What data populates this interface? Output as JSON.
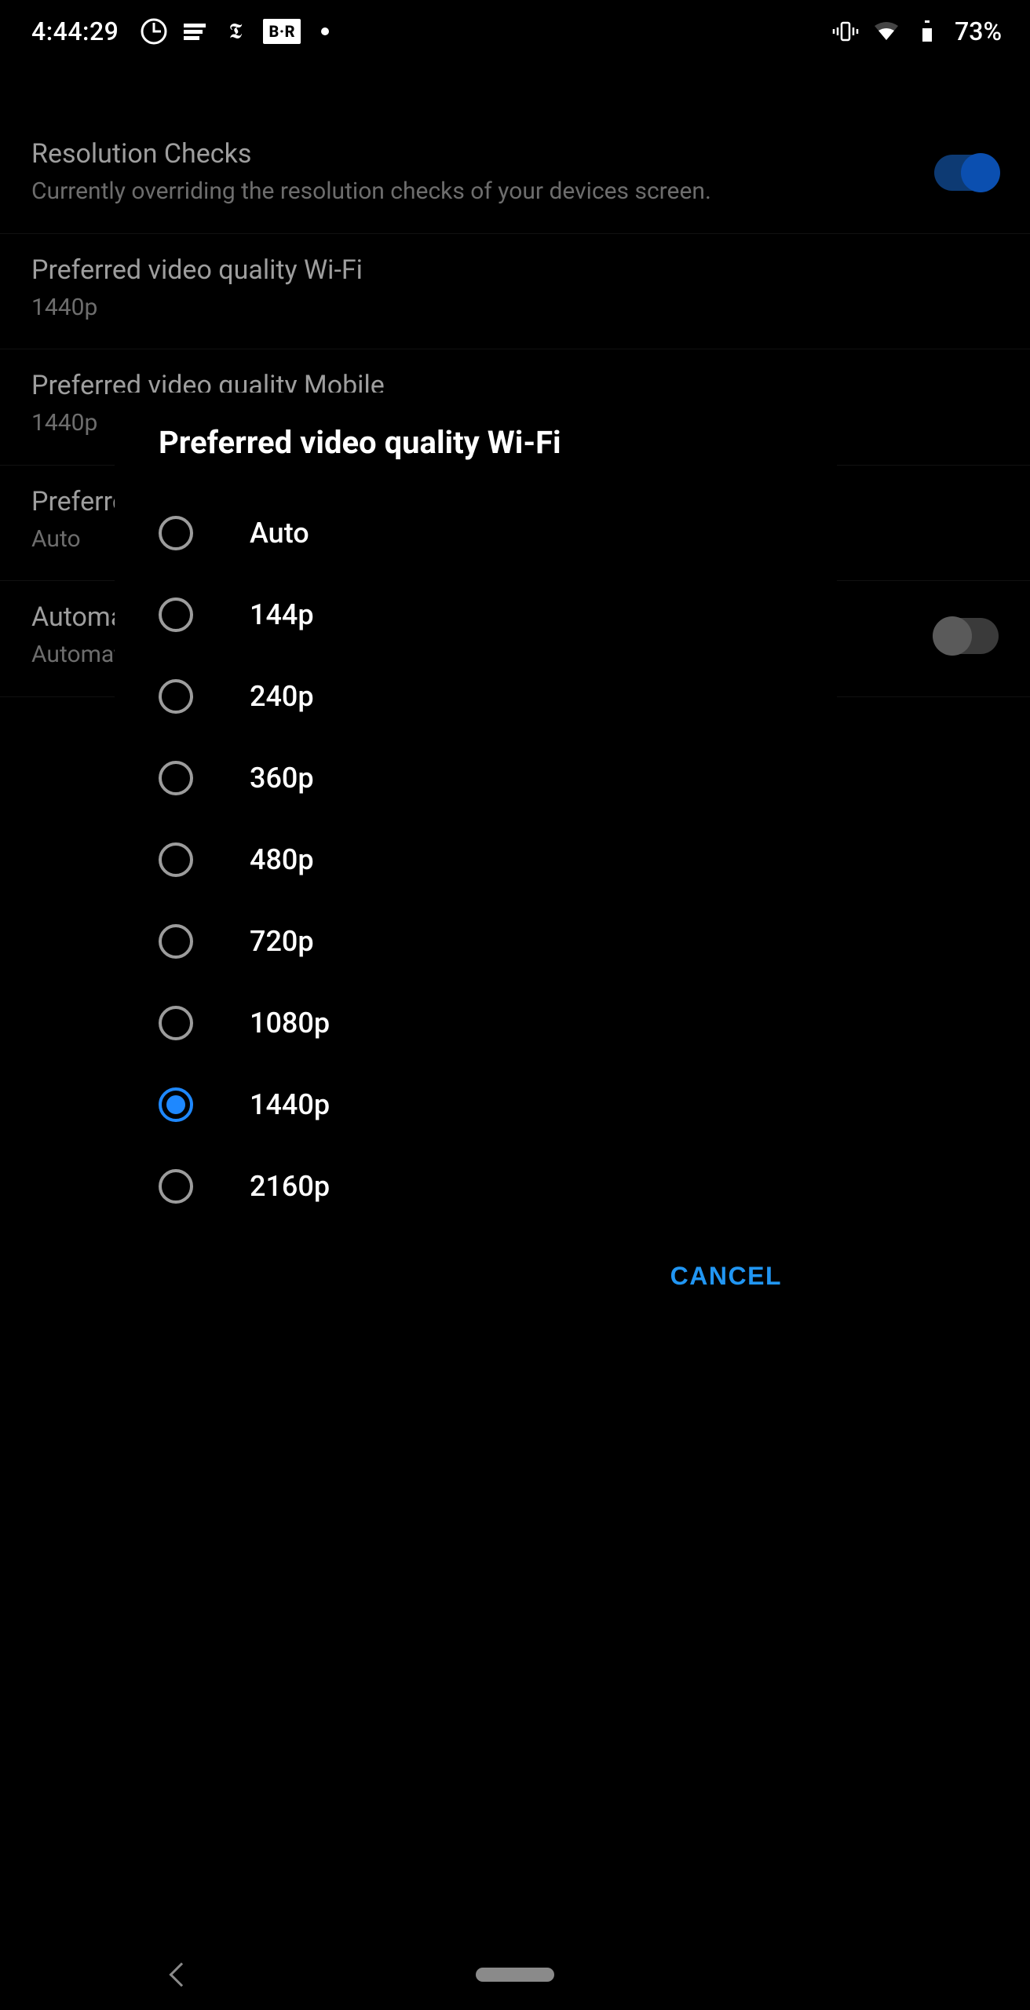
{
  "status": {
    "time": "4:44:29",
    "battery_pct": "73%",
    "icons": [
      "guardian",
      "espn",
      "nyt",
      "br",
      "dot"
    ],
    "right_icons": [
      "vibrate",
      "wifi",
      "battery"
    ]
  },
  "settings": {
    "rows": [
      {
        "title": "Resolution Checks",
        "sub": "Currently overriding the resolution checks of your devices screen.",
        "switch": "on"
      },
      {
        "title": "Preferred video quality Wi-Fi",
        "sub": "1440p",
        "switch": null
      },
      {
        "title": "Preferred video quality Mobile",
        "sub": "1440p",
        "switch": null
      },
      {
        "title": "Preferred video speed",
        "sub": "Auto",
        "switch": null
      },
      {
        "title": "Automatic captions",
        "sub": "Automatic captions",
        "switch": "off"
      }
    ]
  },
  "dialog": {
    "title": "Preferred video quality Wi-Fi",
    "selected": "1440p",
    "options": [
      "Auto",
      "144p",
      "240p",
      "360p",
      "480p",
      "720p",
      "1080p",
      "1440p",
      "2160p"
    ],
    "cancel": "CANCEL"
  }
}
